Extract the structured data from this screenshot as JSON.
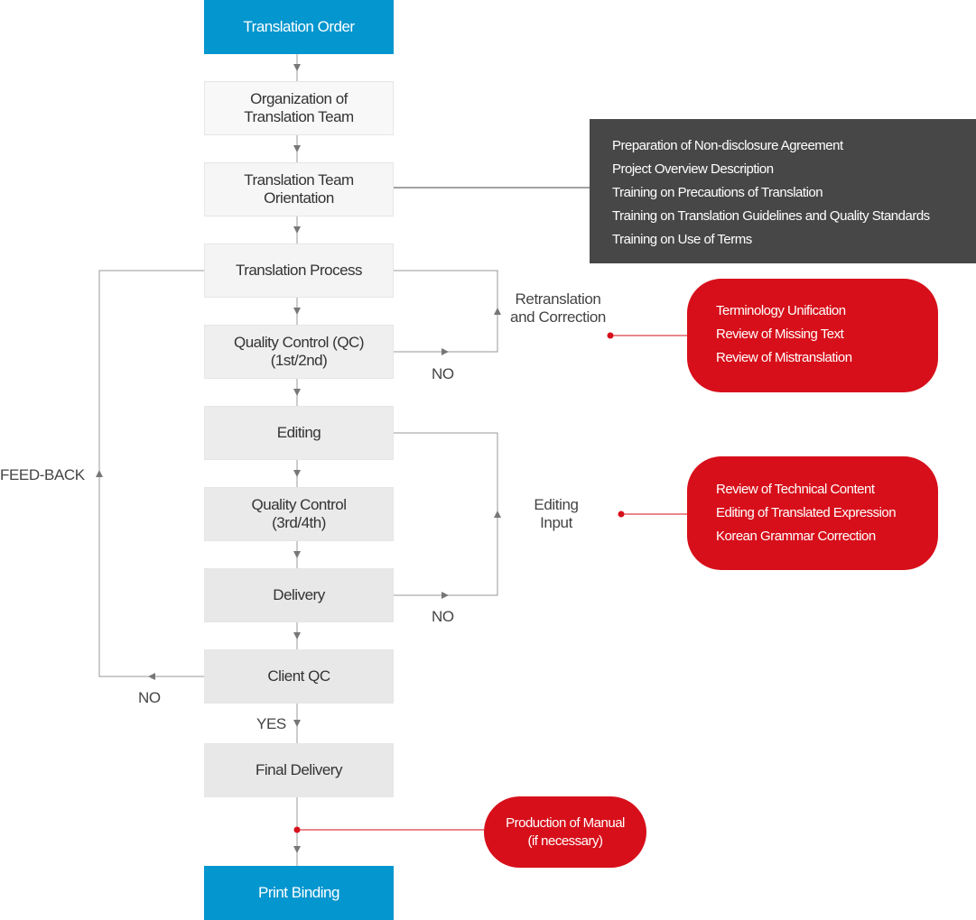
{
  "steps": [
    {
      "label": "Translation Order",
      "bg": "#0396cf"
    },
    {
      "label": "Organization of Translation Team",
      "bg": "#f8f8f8"
    },
    {
      "label": "Translation Team Orientation",
      "bg": "#f6f6f6"
    },
    {
      "label": "Translation Process",
      "bg": "#f4f4f4"
    },
    {
      "label": "Quality Control (QC) (1st/2nd)",
      "bg": "#efefef"
    },
    {
      "label": "Editing",
      "bg": "#ececec"
    },
    {
      "label": "Quality Control (3rd/4th)",
      "bg": "#eaeaea"
    },
    {
      "label": "Delivery",
      "bg": "#e8e8e8"
    },
    {
      "label": "Client QC",
      "bg": "#e8e8e8"
    },
    {
      "label": "Final Delivery",
      "bg": "#e8e8e8"
    },
    {
      "label": "Print Binding",
      "bg": "#0396cf"
    }
  ],
  "labels": {
    "retranslation": "Retranslation and Correction",
    "editing_input": "Editing Input",
    "no1": "NO",
    "no2": "NO",
    "no3": "NO",
    "yes": "YES",
    "feedback": "FEED-BACK"
  },
  "orientation_notes": [
    "Preparation of Non-disclosure Agreement",
    "Project Overview Description",
    "Training on Precautions of Translation",
    "Training on Translation Guidelines and Quality Standards",
    "Training on Use of Terms"
  ],
  "qc_notes": [
    "Terminology Unification",
    "Review of Missing Text",
    "Review of Mistranslation"
  ],
  "editing_notes": [
    "Review of Technical Content",
    "Editing of Translated Expression",
    "Korean Grammar Correction"
  ],
  "manual_note": [
    "Production of Manual",
    "(if necessary)"
  ],
  "colors": {
    "blue": "#0396cf",
    "red": "#d70f1a",
    "dark": "#474747",
    "line": "#9a9a9a"
  }
}
